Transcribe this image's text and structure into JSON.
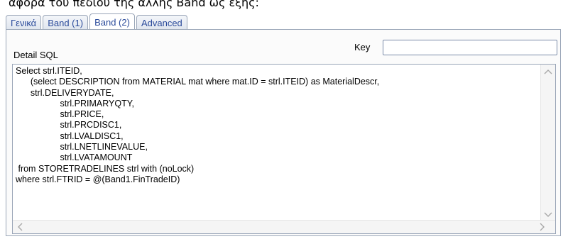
{
  "intro_text": "αφορά του πεδίου της άλλης Band ως εξής:",
  "tabs": [
    {
      "label": "Γενικά",
      "active": false
    },
    {
      "label": "Band (1)",
      "active": false
    },
    {
      "label": "Band (2)",
      "active": true
    },
    {
      "label": "Advanced",
      "active": false
    }
  ],
  "panel": {
    "detail_label": "Detail SQL",
    "key_label": "Key",
    "key_value": ""
  },
  "sql_lines": [
    "Select strl.ITEID,",
    "      (select DESCRIPTION from MATERIAL mat where mat.ID = strl.ITEID) as MaterialDescr,",
    "      strl.DELIVERYDATE,",
    "                  strl.PRIMARYQTY,",
    "                  strl.PRICE,",
    "                  strl.PRCDISC1,",
    "                  strl.LVALDISC1,",
    "                  strl.LNETLINEVALUE,",
    "                  strl.LVATAMOUNT",
    " from STORETRADELINES strl with (noLock)",
    "where strl.FTRID = @(Band1.FinTradeID)"
  ],
  "scroll_icons": {
    "up": "chevron-up-icon",
    "down": "chevron-down-icon",
    "left": "chevron-left-icon",
    "right": "chevron-right-icon"
  }
}
